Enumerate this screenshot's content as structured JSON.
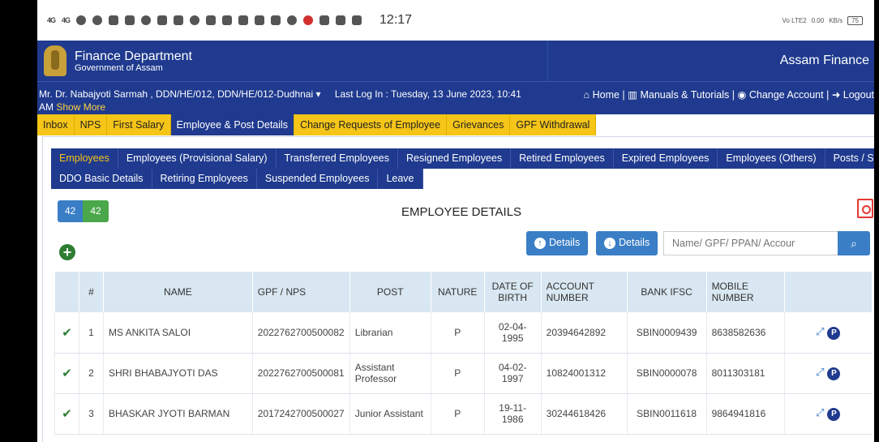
{
  "status_bar": {
    "signal1": "4G",
    "signal2": "4G",
    "time": "12:17",
    "net_rate": "0.00",
    "net_unit": "KB/s",
    "net_type": "Vo LTE2",
    "battery": "75"
  },
  "header": {
    "dept_title": "Finance Department",
    "dept_subtitle": "Government of Assam",
    "app_name": "Assam Finance"
  },
  "userbar": {
    "user": "Mr. Dr. Nabajyoti Sarmah , DDN/HE/012, DDN/HE/012-Dudhnai",
    "last_login": "Last Log In : Tuesday, 13 June 2023, 10:41",
    "am": "AM",
    "show_more": "Show More",
    "links": {
      "home": "Home",
      "manuals": "Manuals & Tutorials",
      "change_account": "Change Account",
      "logout": "Logout"
    }
  },
  "main_tabs": [
    "Inbox",
    "NPS",
    "First Salary",
    "Employee & Post Details",
    "Change Requests of Employee",
    "Grievances",
    "GPF Withdrawal"
  ],
  "sub_tabs_row1": [
    "Employees",
    "Employees (Provisional Salary)",
    "Transferred Employees",
    "Resigned Employees",
    "Retired Employees",
    "Expired Employees",
    "Employees (Others)",
    "Posts / Services"
  ],
  "sub_tabs_row2": [
    "DDO Basic Details",
    "Retiring Employees",
    "Suspended Employees",
    "Leave"
  ],
  "counts": {
    "total": "42",
    "active": "42"
  },
  "page_title": "EMPLOYEE DETAILS",
  "buttons": {
    "upload_details": "Details",
    "download_details": "Details"
  },
  "search": {
    "placeholder": "Name/ GPF/ PPAN/ Accour"
  },
  "table": {
    "headers": [
      "",
      "#",
      "NAME",
      "GPF / NPS",
      "POST",
      "NATURE",
      "DATE OF BIRTH",
      "ACCOUNT NUMBER",
      "BANK IFSC",
      "MOBILE NUMBER",
      ""
    ],
    "rows": [
      {
        "sl": "1",
        "name": "MS ANKITA SALOI",
        "gpf": "2022762700500082",
        "post": "Librarian",
        "nature": "P",
        "dob": "02-04-1995",
        "account": "20394642892",
        "ifsc": "SBIN0009439",
        "mobile": "8638582636"
      },
      {
        "sl": "2",
        "name": "SHRI BHABAJYOTI DAS",
        "gpf": "2022762700500081",
        "post": "Assistant Professor",
        "nature": "P",
        "dob": "04-02-1997",
        "account": "10824001312",
        "ifsc": "SBIN0000078",
        "mobile": "8011303181"
      },
      {
        "sl": "3",
        "name": "BHASKAR JYOTI BARMAN",
        "gpf": "2017242700500027",
        "post": "Junior Assistant",
        "nature": "P",
        "dob": "19-11-1986",
        "account": "30244618426",
        "ifsc": "SBIN0011618",
        "mobile": "9864941816"
      }
    ]
  },
  "colors": {
    "primary": "#1f3a8e",
    "tab_yellow": "#f5c518",
    "button_blue": "#3a7ec6",
    "success": "#2e7d32"
  }
}
